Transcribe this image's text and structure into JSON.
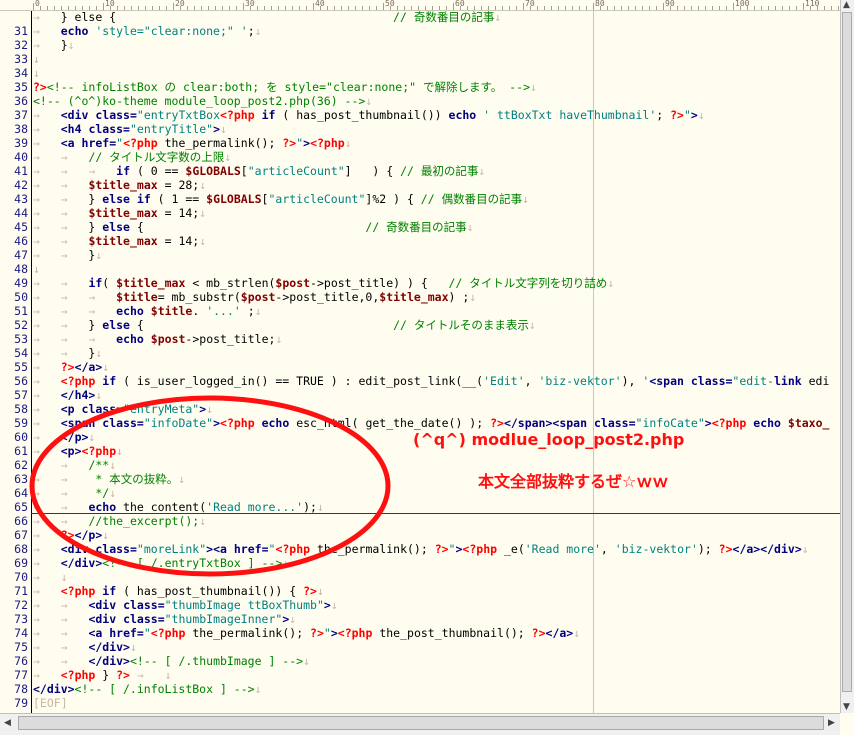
{
  "ruler": {
    "marks": [
      "0",
      "10",
      "20",
      "30",
      "40",
      "50",
      "60",
      "70",
      "80",
      "90",
      "100",
      "110"
    ]
  },
  "editor": {
    "lines": [
      {
        "n": "",
        "html": "<span class='t'>→</span>   } else {                                        <span class='c'>// 奇数番目の記事</span><span class='t'>↓</span>"
      },
      {
        "n": "31",
        "html": "<span class='t'>→</span>   <span class='k'>echo</span> <span class='s'>'style=\"clear:none;\" '</span>;<span class='t'>↓</span>"
      },
      {
        "n": "32",
        "html": "<span class='t'>→</span>   }<span class='t'>↓</span>"
      },
      {
        "n": "33",
        "html": "<span class='t'>↓</span>"
      },
      {
        "n": "34",
        "html": "<span class='t'>↓</span>"
      },
      {
        "n": "35",
        "html": "<span class='p'>?&gt;</span><span class='c'>&lt;!-- infoListBox の clear:both; を style=\"clear:none;\" で解除します。 --&gt;</span><span class='t'>↓</span>"
      },
      {
        "n": "36",
        "html": "<span class='c'>&lt;!-- (^o^)ko-theme module_loop_post2.php(36) --&gt;</span><span class='t'>↓</span>"
      },
      {
        "n": "37",
        "html": "<span class='t'>→</span>   <span class='k'>&lt;div</span> <span class='k'>class=</span><span class='s'>\"entryTxtBox</span><span class='p'>&lt;?php</span> <span class='k'>if</span> ( has_post_thumbnail()) <span class='k'>echo</span> <span class='s'>' ttBoxTxt haveThumbnail'</span>; <span class='p'>?&gt;</span><span class='s'>\"</span><span class='k'>&gt;</span><span class='t'>↓</span>"
      },
      {
        "n": "38",
        "html": "<span class='t'>→</span>   <span class='k'>&lt;h4</span> <span class='k'>class=</span><span class='s'>\"entryTitle\"</span><span class='k'>&gt;</span><span class='t'>↓</span>"
      },
      {
        "n": "39",
        "html": "<span class='t'>→</span>   <span class='k'>&lt;a</span> <span class='k'>href=</span><span class='s'>\"</span><span class='p'>&lt;?php</span> the_permalink(); <span class='p'>?&gt;</span><span class='s'>\"</span><span class='k'>&gt;</span><span class='p'>&lt;?php</span><span class='t'>↓</span>"
      },
      {
        "n": "40",
        "html": "<span class='t'>→</span>   <span class='t'>→</span>   <span class='c'>// タイトル文字数の上限</span><span class='t'>↓</span>"
      },
      {
        "n": "41",
        "html": "<span class='t'>→</span>   <span class='t'>→</span>   <span class='t'>→</span>   <span class='k'>if</span> ( 0 == <span class='v'>$GLOBALS</span>[<span class='s'>\"articleCount\"</span>]   ) { <span class='c'>// 最初の記事</span><span class='t'>↓</span>"
      },
      {
        "n": "42",
        "html": "<span class='t'>→</span>   <span class='t'>→</span>   <span class='v'>$title_max</span> = 28;<span class='t'>↓</span>"
      },
      {
        "n": "43",
        "html": "<span class='t'>→</span>   <span class='t'>→</span>   } <span class='k'>else if</span> ( 1 == <span class='v'>$GLOBALS</span>[<span class='s'>\"articleCount\"</span>]%2 ) { <span class='c'>// 偶数番目の記事</span><span class='t'>↓</span>"
      },
      {
        "n": "44",
        "html": "<span class='t'>→</span>   <span class='t'>→</span>   <span class='v'>$title_max</span> = 14;<span class='t'>↓</span>"
      },
      {
        "n": "45",
        "html": "<span class='t'>→</span>   <span class='t'>→</span>   } <span class='k'>else</span> {                                <span class='c'>// 奇数番目の記事</span><span class='t'>↓</span>"
      },
      {
        "n": "46",
        "html": "<span class='t'>→</span>   <span class='t'>→</span>   <span class='v'>$title_max</span> = 14;<span class='t'>↓</span>"
      },
      {
        "n": "47",
        "html": "<span class='t'>→</span>   <span class='t'>→</span>   }<span class='t'>↓</span>"
      },
      {
        "n": "48",
        "html": "<span class='t'>↓</span>"
      },
      {
        "n": "49",
        "html": "<span class='t'>→</span>   <span class='t'>→</span>   <span class='k'>if</span>( <span class='v'>$title_max</span> &lt; mb_strlen(<span class='v'>$post</span>-&gt;post_title) ) {   <span class='c'>// タイトル文字列を切り詰め</span><span class='t'>↓</span>"
      },
      {
        "n": "50",
        "html": "<span class='t'>→</span>   <span class='t'>→</span>   <span class='t'>→</span>   <span class='v'>$title</span>= mb_substr(<span class='v'>$post</span>-&gt;post_title,0,<span class='v'>$title_max</span>) ;<span class='t'>↓</span>"
      },
      {
        "n": "51",
        "html": "<span class='t'>→</span>   <span class='t'>→</span>   <span class='t'>→</span>   <span class='k'>echo</span> <span class='v'>$title</span>. <span class='s'>'...'</span> ;<span class='t'>↓</span>"
      },
      {
        "n": "52",
        "html": "<span class='t'>→</span>   <span class='t'>→</span>   } <span class='k'>else</span> {                                    <span class='c'>// タイトルそのまま表示</span><span class='t'>↓</span>"
      },
      {
        "n": "53",
        "html": "<span class='t'>→</span>   <span class='t'>→</span>   <span class='t'>→</span>   <span class='k'>echo</span> <span class='v'>$post</span>-&gt;post_title;<span class='t'>↓</span>"
      },
      {
        "n": "54",
        "html": "<span class='t'>→</span>   <span class='t'>→</span>   }<span class='t'>↓</span>"
      },
      {
        "n": "55",
        "html": "<span class='t'>→</span>   <span class='p'>?&gt;</span><span class='k'>&lt;/a&gt;</span><span class='t'>↓</span>"
      },
      {
        "n": "56",
        "html": "<span class='t'>→</span>   <span class='p'>&lt;?php</span> <span class='k'>if</span> ( is_user_logged_in() == TRUE ) : edit_post_link(__(<span class='s'>'Edit'</span>, <span class='s'>'biz-vektor'</span>), <span class='s'>'</span><span class='k'>&lt;span</span> <span class='k'>class=</span><span class='s'>\"edit-</span><span class='k'>link</span> edi"
      },
      {
        "n": "57",
        "html": "<span class='t'>→</span>   <span class='k'>&lt;/h4&gt;</span><span class='t'>↓</span>"
      },
      {
        "n": "58",
        "html": "<span class='t'>→</span>   <span class='k'>&lt;p</span> <span class='k'>class=</span><span class='s'>\"entryMeta\"</span><span class='k'>&gt;</span><span class='t'>↓</span>"
      },
      {
        "n": "59",
        "html": "<span class='t'>→</span>   <span class='k'>&lt;span</span> <span class='k'>class=</span><span class='s'>\"infoDate\"</span><span class='k'>&gt;</span><span class='p'>&lt;?php</span> <span class='k'>echo</span> esc_html( get_the_date() ); <span class='p'>?&gt;</span><span class='k'>&lt;/span&gt;&lt;span</span> <span class='k'>class=</span><span class='s'>\"infoCate\"</span><span class='k'>&gt;</span><span class='p'>&lt;?php</span> <span class='k'>echo</span> <span class='v'>$taxo_</span>"
      },
      {
        "n": "60",
        "html": "<span class='t'>→</span>   <span class='k'>&lt;/p&gt;</span><span class='t'>↓</span>"
      },
      {
        "n": "61",
        "html": "<span class='t'>→</span>   <span class='k'>&lt;p&gt;</span><span class='p'>&lt;?php</span><span class='t'>↓</span>"
      },
      {
        "n": "62",
        "html": "<span class='t'>→</span>   <span class='t'>→</span>   <span class='c'>/**</span><span class='t'>↓</span>"
      },
      {
        "n": "63",
        "html": "<span class='t'>→</span>   <span class='t'>→</span>   <span class='c'> * 本文の抜粋。</span><span class='t'>↓</span>"
      },
      {
        "n": "64",
        "html": "<span class='t'>→</span>   <span class='t'>→</span>   <span class='c'> */</span><span class='t'>↓</span>"
      },
      {
        "n": "65",
        "html": "<span class='t'>→</span>   <span class='t'>→</span>   <span class='k'>echo</span> the_content(<span class='s'>'Read more...'</span>);<span class='t'>↓</span>"
      },
      {
        "n": "66",
        "html": "<span class='t'>→</span>   <span class='t'>→</span>   <span class='c'>//the_excerpt();</span><span class='t'>↓</span>"
      },
      {
        "n": "67",
        "html": "<span class='t'>→</span>   <span class='p'>?&gt;</span><span class='k'>&lt;/p&gt;</span><span class='t'>↓</span>"
      },
      {
        "n": "68",
        "html": "<span class='t'>→</span>   <span class='k'>&lt;div</span> <span class='k'>class=</span><span class='s'>\"moreLink\"</span><span class='k'>&gt;&lt;a</span> <span class='k'>href=</span><span class='s'>\"</span><span class='p'>&lt;?php</span> the_permalink(); <span class='p'>?&gt;</span><span class='s'>\"</span><span class='k'>&gt;</span><span class='p'>&lt;?php</span> _e(<span class='s'>'Read more'</span>, <span class='s'>'biz-vektor'</span>); <span class='p'>?&gt;</span><span class='k'>&lt;/a&gt;&lt;/div&gt;</span><span class='t'>↓</span>"
      },
      {
        "n": "69",
        "html": "<span class='t'>→</span>   <span class='k'>&lt;/div&gt;</span><span class='c'>&lt;!-- [ /.entryTxtBox ] --&gt;</span><span class='t'>↓</span>"
      },
      {
        "n": "70",
        "html": "<span class='t'>→</span>   <span class='t'>↓</span>"
      },
      {
        "n": "71",
        "html": "<span class='t'>→</span>   <span class='p'>&lt;?php</span> <span class='k'>if</span> ( has_post_thumbnail()) { <span class='p'>?&gt;</span><span class='t'>↓</span>"
      },
      {
        "n": "72",
        "html": "<span class='t'>→</span>   <span class='t'>→</span>   <span class='k'>&lt;div</span> <span class='k'>class=</span><span class='s'>\"thumbImage ttBoxThumb\"</span><span class='k'>&gt;</span><span class='t'>↓</span>"
      },
      {
        "n": "73",
        "html": "<span class='t'>→</span>   <span class='t'>→</span>   <span class='k'>&lt;div</span> <span class='k'>class=</span><span class='s'>\"thumbImageInner\"</span><span class='k'>&gt;</span><span class='t'>↓</span>"
      },
      {
        "n": "74",
        "html": "<span class='t'>→</span>   <span class='t'>→</span>   <span class='k'>&lt;a</span> <span class='k'>href=</span><span class='s'>\"</span><span class='p'>&lt;?php</span> the_permalink(); <span class='p'>?&gt;</span><span class='s'>\"</span><span class='k'>&gt;</span><span class='p'>&lt;?php</span> the_post_thumbnail(); <span class='p'>?&gt;</span><span class='k'>&lt;/a&gt;</span><span class='t'>↓</span>"
      },
      {
        "n": "75",
        "html": "<span class='t'>→</span>   <span class='t'>→</span>   <span class='k'>&lt;/div&gt;</span><span class='t'>↓</span>"
      },
      {
        "n": "76",
        "html": "<span class='t'>→</span>   <span class='t'>→</span>   <span class='k'>&lt;/div&gt;</span><span class='c'>&lt;!-- [ /.thumbImage ] --&gt;</span><span class='t'>↓</span>"
      },
      {
        "n": "77",
        "html": "<span class='t'>→</span>   <span class='p'>&lt;?php</span> } <span class='p'>?&gt;</span> <span class='t'>→</span>   <span class='t'>↓</span>"
      },
      {
        "n": "78",
        "html": "<span class='k'>&lt;/div&gt;</span><span class='c'>&lt;!-- [ /.infoListBox ] --&gt;</span><span class='t'>↓</span>"
      },
      {
        "n": "79",
        "html": "<span class='t'>[EOF]</span>"
      }
    ]
  },
  "annotation": {
    "title": "(^q^) modlue_loop_post2.php",
    "subtitle": "本文全部抜粋するぜ☆ｗｗ"
  },
  "colors": {
    "background": "#fffdf0",
    "comment": "#008000",
    "php_tag": "#ff0000",
    "annotation": "#ff1010"
  }
}
